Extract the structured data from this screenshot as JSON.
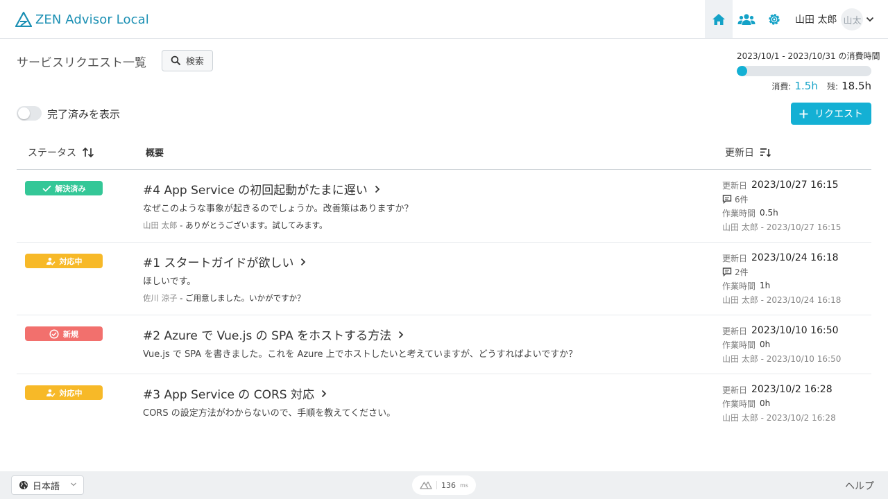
{
  "header": {
    "app_name": "ZEN Advisor Local",
    "user_name": "山田 太郎",
    "avatar_text": "山太",
    "icons": [
      "home-icon",
      "users-icon",
      "gear-icon",
      "chevron-down-icon"
    ]
  },
  "page": {
    "title": "サービスリクエスト一覧",
    "search_label": "検索"
  },
  "usage": {
    "period": "2023/10/1 - 2023/10/31 の消費時間",
    "progress_fraction": 0.075,
    "used_label": "消費:",
    "used_value": "1.5h",
    "remaining_label": "残:",
    "remaining_value": "18.5h"
  },
  "filters": {
    "show_completed_label": "完了済みを表示",
    "show_completed": false,
    "request_button": "リクエスト"
  },
  "table": {
    "headers": {
      "status": "ステータス",
      "summary": "概要",
      "updated": "更新日"
    },
    "rows": [
      {
        "status": "解決済み",
        "status_color": "#34c797",
        "status_icon": "check-icon",
        "title": "#4 App Service の初回起動がたまに遅い",
        "description": "なぜこのような事象が起きるのでしょうか。改善策はありますか？",
        "last_author": "山田 太郎",
        "last_message": " - ありがとうございます。試してみます。",
        "updated_label": "更新日",
        "updated": "2023/10/27 16:15",
        "comments": "6件",
        "work_label": "作業時間",
        "work": "0.5h",
        "last_update": "山田 太郎 - 2023/10/27 16:15"
      },
      {
        "status": "対応中",
        "status_color": "#f7b928",
        "status_icon": "user-check-icon",
        "title": "#1 スタートガイドが欲しい",
        "description": "ほしいです。",
        "last_author": "佐川 涼子",
        "last_message": " - ご用意しました。いかがですか？",
        "updated_label": "更新日",
        "updated": "2023/10/24 16:18",
        "comments": "2件",
        "work_label": "作業時間",
        "work": "1h",
        "last_update": "山田 太郎 - 2023/10/24 16:18"
      },
      {
        "status": "新規",
        "status_color": "#f2706d",
        "status_icon": "check-circle-icon",
        "title": "#2 Azure で Vue.js の SPA をホストする方法",
        "description": "Vue.js で SPA を書きました。これを Azure 上でホストしたいと考えていますが、どうすればよいですか？",
        "updated_label": "更新日",
        "updated": "2023/10/10 16:50",
        "work_label": "作業時間",
        "work": "0h",
        "last_update": "山田 太郎 - 2023/10/10 16:50"
      },
      {
        "status": "対応中",
        "status_color": "#f7b928",
        "status_icon": "user-check-icon",
        "title": "#3 App Service の CORS 対応",
        "description": "CORS の設定方法がわからないので、手順を教えてください。",
        "updated_label": "更新日",
        "updated": "2023/10/2 16:28",
        "work_label": "作業時間",
        "work": "0h",
        "last_update": "山田 太郎 - 2023/10/2 16:28"
      }
    ]
  },
  "footer": {
    "language": "日本語",
    "render_time": "136",
    "render_unit": "ms",
    "help": "ヘルプ"
  }
}
